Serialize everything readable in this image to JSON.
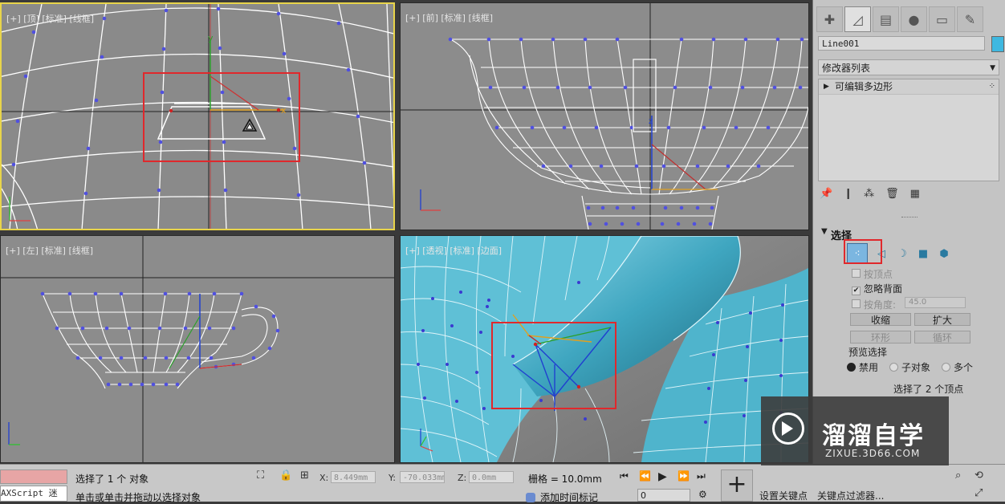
{
  "viewports": {
    "top": {
      "label": "[+] [顶] [标准] [线框]"
    },
    "front": {
      "label": "[+] [前] [标准] [线框]"
    },
    "left": {
      "label": "[+] [左] [标准] [线框]"
    },
    "persp": {
      "label": "[+] [透视] [标准] [边面]"
    },
    "axis_x": "x",
    "axis_y": "y",
    "axis_z": "z"
  },
  "command_panel": {
    "object_name": "Line001",
    "object_color": "#3fb8e0",
    "modifier_list": "修改器列表",
    "stack_items": [
      "可编辑多边形"
    ],
    "selection": {
      "title": "选择",
      "by_vertex": "按顶点",
      "ignore_backface": "忽略背面",
      "by_angle": "按角度:",
      "angle_value": "45.0",
      "shrink": "收缩",
      "grow": "扩大",
      "ring": "环形",
      "loop": "循环",
      "preview_label": "预览选择",
      "preview_options": [
        "禁用",
        "子对象",
        "多个"
      ],
      "status": "选择了 2 个顶点"
    }
  },
  "status_bar": {
    "maxscript": "AXScript 迷",
    "selected": "选择了 1 个 对象",
    "prompt": "单击或单击并拖动以选择对象",
    "x_label": "X:",
    "x_value": "8.449mm",
    "y_label": "Y:",
    "y_value": "-70.033mm",
    "z_label": "Z:",
    "z_value": "0.0mm",
    "grid": "栅格 = 10.0mm",
    "add_time_tag": "添加时间标记",
    "frame": "0",
    "set_key": "设置关键点",
    "key_filter": "关键点过滤器..."
  },
  "watermark": {
    "title": "溜溜自学",
    "url": "ZIXUE.3D66.COM"
  },
  "colors": {
    "accent_red": "#e0282c",
    "active_border": "#e8d44a",
    "teapot": "#4fb7cf",
    "vertex_blue": "#4040e0"
  }
}
